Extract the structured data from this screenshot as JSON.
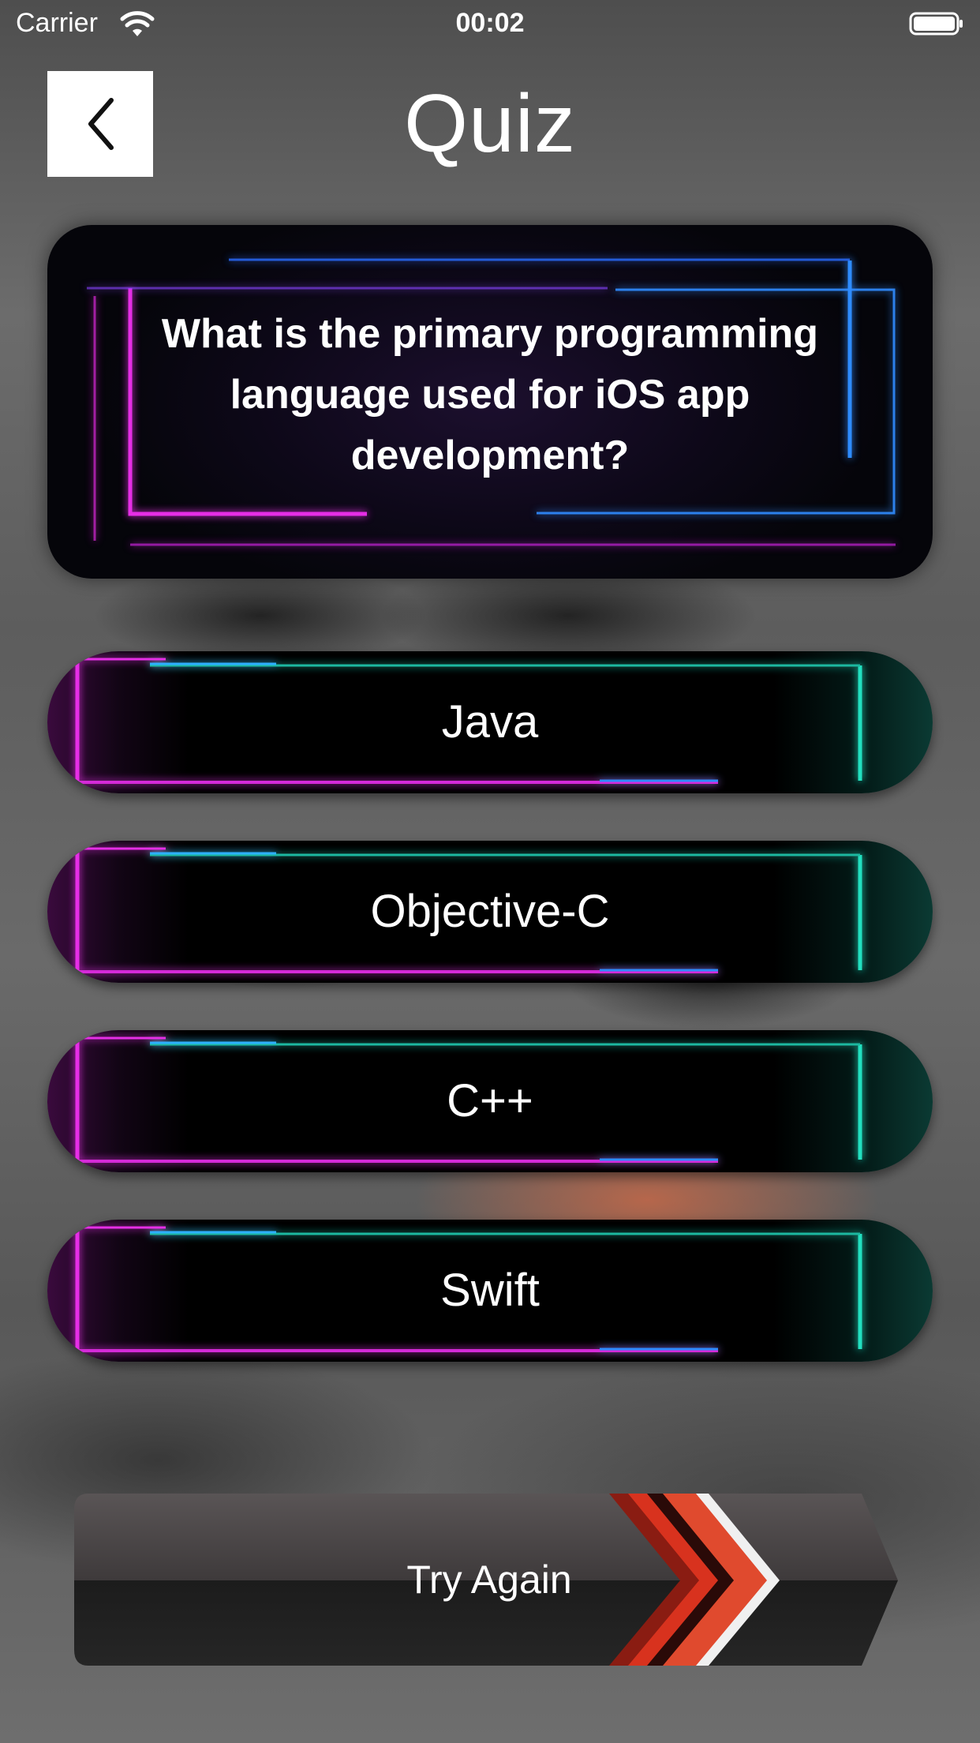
{
  "status_bar": {
    "carrier": "Carrier",
    "time": "00:02",
    "wifi_icon": "wifi-icon",
    "battery_icon": "battery-icon"
  },
  "header": {
    "back_icon": "chevron-left-icon",
    "title": "Quiz"
  },
  "question": {
    "text": "What is the primary programming language used for iOS app development?"
  },
  "answers": [
    {
      "label": "Java"
    },
    {
      "label": "Objective-C"
    },
    {
      "label": "C++"
    },
    {
      "label": "Swift"
    }
  ],
  "actions": {
    "try_again_label": "Try Again",
    "arrow_icon": "chevron-arrows-icon"
  },
  "colors": {
    "neon_magenta": "#e62ee6",
    "neon_cyan": "#20e0c0",
    "neon_blue": "#2f8cff",
    "arrow_red": "#d8321e"
  }
}
